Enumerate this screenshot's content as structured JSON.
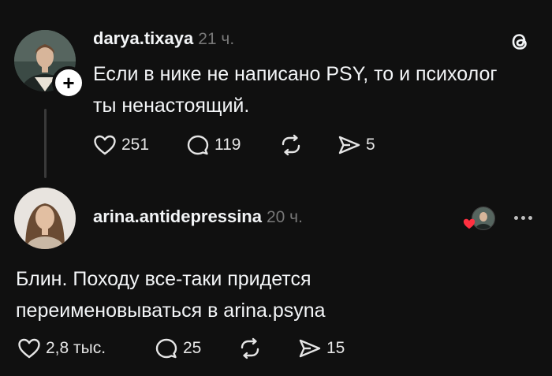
{
  "post": {
    "username": "darya.tixaya",
    "time": "21 ч.",
    "text_line1": "Если в нике не написано PSY, то и психолог",
    "text_line2": "ты ненастоящий.",
    "likes": "251",
    "comments": "119",
    "shares": "5",
    "app_icon": "threads-logo-icon"
  },
  "reply": {
    "username": "arina.antidepressina",
    "time": "20 ч.",
    "text_line1": "Блин. Походу все-таки придется",
    "text_line2": "переименовываться в arina.psyna",
    "likes": "2,8 тыс.",
    "comments": "25",
    "shares": "15"
  },
  "colors": {
    "background": "#101010",
    "text": "#f3f5f7",
    "muted": "#777777",
    "heart_red": "#ff3040"
  }
}
